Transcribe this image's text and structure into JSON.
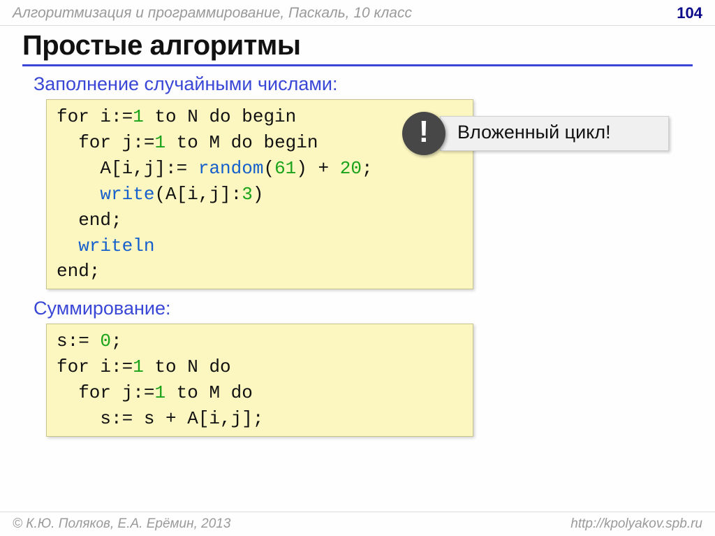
{
  "header": {
    "breadcrumb": "Алгоритмизация и программирование, Паскаль, 10 класс",
    "page_number": "104"
  },
  "title": "Простые алгоритмы",
  "section1": {
    "heading": "Заполнение случайными числами:",
    "code": {
      "l1a": "for i:=",
      "l1b": "1",
      "l1c": " to N do begin",
      "l2a": "  for j:=",
      "l2b": "1",
      "l2c": " to M do begin",
      "l3a": "    A[i,j]:= ",
      "l3b": "random",
      "l3c": "(",
      "l3d": "61",
      "l3e": ") + ",
      "l3f": "20",
      "l3g": ";",
      "l4a": "    ",
      "l4b": "write",
      "l4c": "(A[i,j]:",
      "l4d": "3",
      "l4e": ")",
      "l5": "  end;",
      "l6a": "  ",
      "l6b": "writeln",
      "l7": "end;"
    }
  },
  "exclaim": "!",
  "callout": "Вложенный цикл!",
  "section2": {
    "heading": "Суммирование:",
    "code": {
      "l1a": "s:= ",
      "l1b": "0",
      "l1c": ";",
      "l2a": "for i:=",
      "l2b": "1",
      "l2c": " to N do",
      "l3a": "  for j:=",
      "l3b": "1",
      "l3c": " to M do",
      "l4": "    s:= s + A[i,j];"
    }
  },
  "footer": {
    "copyright": "© К.Ю. Поляков, Е.А. Ерёмин, 2013",
    "url": "http://kpolyakov.spb.ru"
  }
}
